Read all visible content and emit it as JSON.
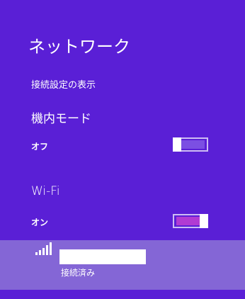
{
  "panel": {
    "title": "ネットワーク",
    "view_connection_settings": "接続設定の表示"
  },
  "airplane_mode": {
    "heading": "機内モード",
    "state_label": "オフ",
    "enabled": false
  },
  "wifi": {
    "heading": "Wi-Fi",
    "state_label": "オン",
    "enabled": true
  },
  "networks": [
    {
      "name": "",
      "status": "接続済み",
      "signal_bars": 5,
      "icon": "wifi-signal-icon"
    }
  ],
  "colors": {
    "background": "#5a1fd6",
    "toggle_on": "#b13bd3",
    "selected_item": "#8466d6"
  }
}
